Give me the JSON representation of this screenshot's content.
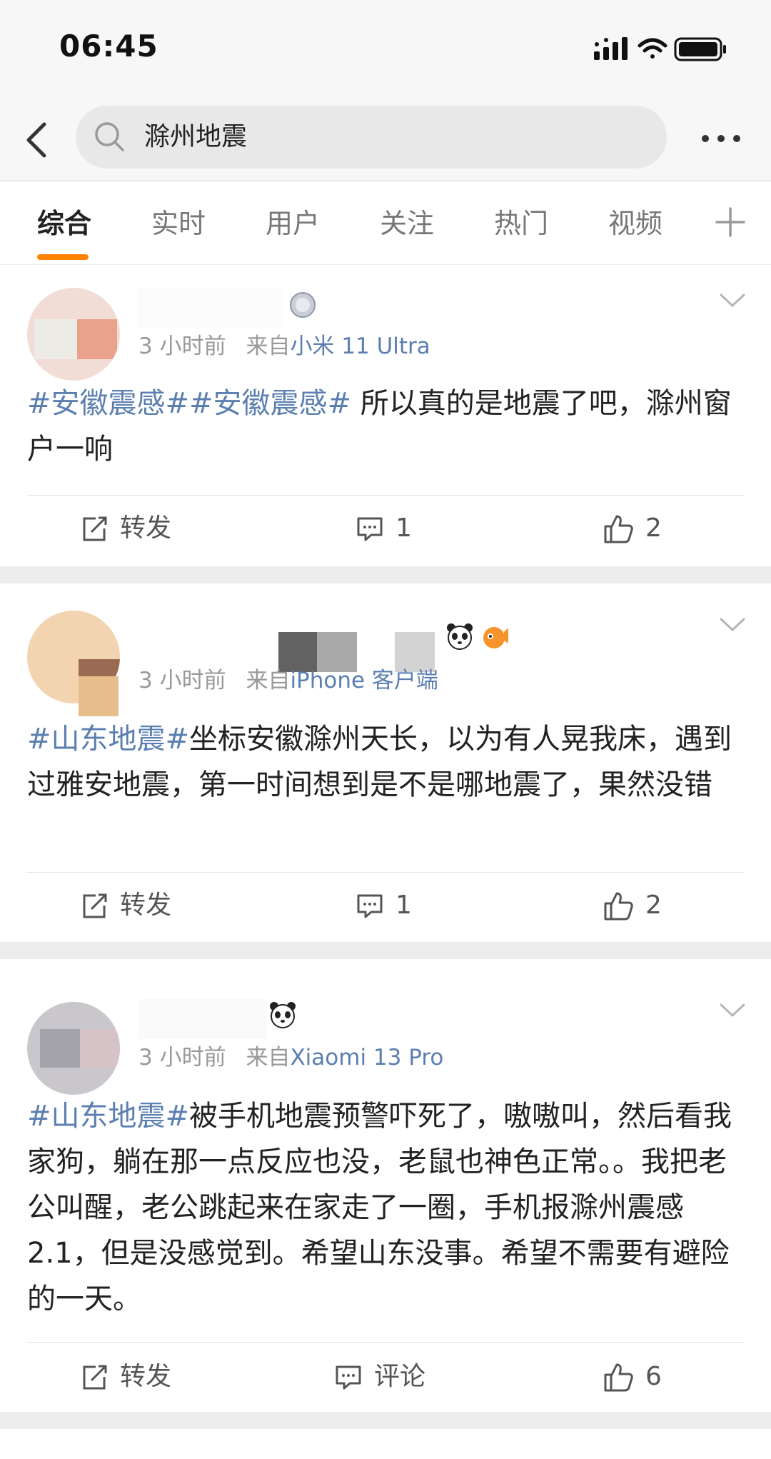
{
  "status": {
    "time": "06:45"
  },
  "search": {
    "query": "滁州地震"
  },
  "tabs": [
    "综合",
    "实时",
    "用户",
    "关注",
    "热门",
    "视频"
  ],
  "posts": [
    {
      "time": "3 小时前",
      "source_prefix": "来自",
      "device": "小米 11 Ultra",
      "tags": [
        "#安徽震感#",
        "#安徽震感#"
      ],
      "text": " 所以真的是地震了吧，滁州窗户一响",
      "repost_label": "转发",
      "comment_count": "1",
      "like_count": "2"
    },
    {
      "time": "3 小时前",
      "source_prefix": "来自",
      "device": "iPhone 客户端",
      "tags": [
        "#山东地震#"
      ],
      "text": "坐标安徽滁州天长，以为有人晃我床，遇到过雅安地震，第一时间想到是不是哪地震了，果然没错",
      "repost_label": "转发",
      "comment_count": "1",
      "like_count": "2"
    },
    {
      "time": "3 小时前",
      "source_prefix": "来自",
      "device": "Xiaomi 13 Pro",
      "tags": [
        "#山东地震#"
      ],
      "text": "被手机地震预警吓死了，嗷嗷叫，然后看我家狗，躺在那一点反应也没，老鼠也神色正常。。我把老公叫醒，老公跳起来在家走了一圈，手机报滁州震感 2.1，但是没感觉到。希望山东没事。希望不需要有避险的一天。",
      "repost_label": "转发",
      "comment_label": "评论",
      "like_count": "6"
    }
  ],
  "colors": {
    "accent": "#ff8200",
    "link": "#5b7fb0",
    "separator": "#ededed"
  }
}
